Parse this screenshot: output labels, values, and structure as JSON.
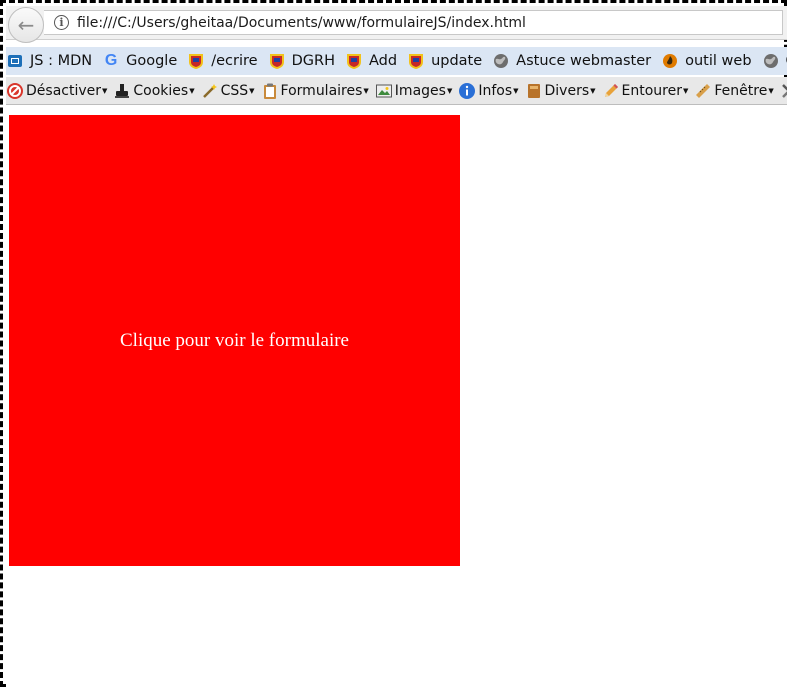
{
  "url": "file:///C:/Users/gheitaa/Documents/www/formulaireJS/index.html",
  "bookmarks": [
    {
      "label": "JS : MDN"
    },
    {
      "label": "Google"
    },
    {
      "label": "/ecrire"
    },
    {
      "label": "DGRH"
    },
    {
      "label": "Add"
    },
    {
      "label": "update"
    },
    {
      "label": "Astuce webmaster"
    },
    {
      "label": "outil web"
    },
    {
      "label": "Co"
    }
  ],
  "devbar": [
    {
      "label": "Désactiver"
    },
    {
      "label": "Cookies"
    },
    {
      "label": "CSS"
    },
    {
      "label": "Formulaires"
    },
    {
      "label": "Images"
    },
    {
      "label": "Infos"
    },
    {
      "label": "Divers"
    },
    {
      "label": "Entourer"
    },
    {
      "label": "Fenêtre"
    }
  ],
  "content": {
    "box_label": "Clique pour voir le formulaire",
    "box_color": "#ff0000"
  }
}
